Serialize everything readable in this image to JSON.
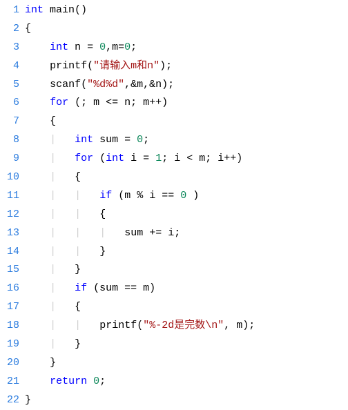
{
  "language": "c",
  "line_count": 22,
  "lines": [
    {
      "n": 1,
      "indent": "",
      "tokens": [
        [
          "k",
          "int"
        ],
        [
          "p",
          " main()"
        ]
      ]
    },
    {
      "n": 2,
      "indent": "",
      "tokens": [
        [
          "p",
          "{"
        ]
      ]
    },
    {
      "n": 3,
      "indent": "    ",
      "tokens": [
        [
          "k",
          "int"
        ],
        [
          "p",
          " n = "
        ],
        [
          "n",
          "0"
        ],
        [
          "p",
          ",m="
        ],
        [
          "n",
          "0"
        ],
        [
          "p",
          ";"
        ]
      ]
    },
    {
      "n": 4,
      "indent": "    ",
      "tokens": [
        [
          "fn",
          "printf"
        ],
        [
          "p",
          "("
        ],
        [
          "s",
          "\"请输入m和n\""
        ],
        [
          "p",
          ");"
        ]
      ]
    },
    {
      "n": 5,
      "indent": "    ",
      "tokens": [
        [
          "fn",
          "scanf"
        ],
        [
          "p",
          "("
        ],
        [
          "s",
          "\"%d%d\""
        ],
        [
          "p",
          ",&m,&n);"
        ]
      ]
    },
    {
      "n": 6,
      "indent": "    ",
      "tokens": [
        [
          "k",
          "for"
        ],
        [
          "p",
          " (; m <= n; m++)"
        ]
      ]
    },
    {
      "n": 7,
      "indent": "    ",
      "tokens": [
        [
          "p",
          "{"
        ]
      ]
    },
    {
      "n": 8,
      "indent": "    |   ",
      "tokens": [
        [
          "k",
          "int"
        ],
        [
          "p",
          " sum = "
        ],
        [
          "n",
          "0"
        ],
        [
          "p",
          ";"
        ]
      ]
    },
    {
      "n": 9,
      "indent": "    |   ",
      "tokens": [
        [
          "k",
          "for"
        ],
        [
          "p",
          " ("
        ],
        [
          "k",
          "int"
        ],
        [
          "p",
          " i = "
        ],
        [
          "n",
          "1"
        ],
        [
          "p",
          "; i < m; i++)"
        ]
      ]
    },
    {
      "n": 10,
      "indent": "    |   ",
      "tokens": [
        [
          "p",
          "{"
        ]
      ]
    },
    {
      "n": 11,
      "indent": "    |   |   ",
      "tokens": [
        [
          "k",
          "if"
        ],
        [
          "p",
          " (m % i == "
        ],
        [
          "n",
          "0"
        ],
        [
          "p",
          " )"
        ]
      ]
    },
    {
      "n": 12,
      "indent": "    |   |   ",
      "tokens": [
        [
          "p",
          "{"
        ]
      ]
    },
    {
      "n": 13,
      "indent": "    |   |   |   ",
      "tokens": [
        [
          "p",
          "sum += i;"
        ]
      ]
    },
    {
      "n": 14,
      "indent": "    |   |   ",
      "tokens": [
        [
          "p",
          "}"
        ]
      ]
    },
    {
      "n": 15,
      "indent": "    |   ",
      "tokens": [
        [
          "p",
          "}"
        ]
      ]
    },
    {
      "n": 16,
      "indent": "    |   ",
      "tokens": [
        [
          "k",
          "if"
        ],
        [
          "p",
          " (sum == m)"
        ]
      ]
    },
    {
      "n": 17,
      "indent": "    |   ",
      "tokens": [
        [
          "p",
          "{"
        ]
      ]
    },
    {
      "n": 18,
      "indent": "    |   |   ",
      "tokens": [
        [
          "fn",
          "printf"
        ],
        [
          "p",
          "("
        ],
        [
          "s",
          "\"%-2d是完数\\n\""
        ],
        [
          "p",
          ", m);"
        ]
      ]
    },
    {
      "n": 19,
      "indent": "    |   ",
      "tokens": [
        [
          "p",
          "}"
        ]
      ]
    },
    {
      "n": 20,
      "indent": "    ",
      "tokens": [
        [
          "p",
          "}"
        ]
      ]
    },
    {
      "n": 21,
      "indent": "    ",
      "tokens": [
        [
          "k",
          "return"
        ],
        [
          "p",
          " "
        ],
        [
          "n",
          "0"
        ],
        [
          "p",
          ";"
        ]
      ]
    },
    {
      "n": 22,
      "indent": "",
      "tokens": [
        [
          "p",
          "}"
        ]
      ]
    }
  ]
}
